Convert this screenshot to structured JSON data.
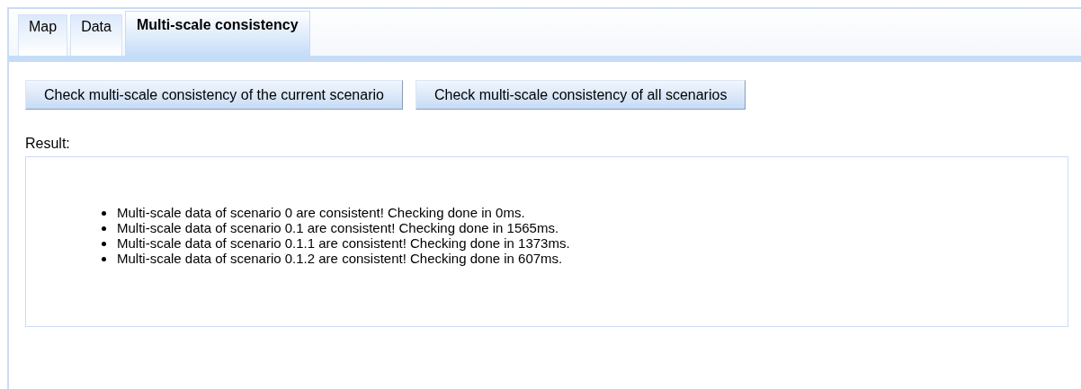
{
  "tabs": [
    {
      "label": "Map",
      "selected": false
    },
    {
      "label": "Data",
      "selected": false
    },
    {
      "label": "Multi-scale consistency",
      "selected": true
    }
  ],
  "buttons": [
    "Check multi-scale consistency of the current scenario",
    "Check multi-scale consistency of all scenarios"
  ],
  "result": {
    "label": "Result:",
    "items": [
      "Multi-scale data of scenario 0 are consistent! Checking done in 0ms.",
      "Multi-scale data of scenario 0.1 are consistent! Checking done in 1565ms.",
      "Multi-scale data of scenario 0.1.1 are consistent! Checking done in 1373ms.",
      "Multi-scale data of scenario 0.1.2 are consistent! Checking done in 607ms."
    ]
  }
}
